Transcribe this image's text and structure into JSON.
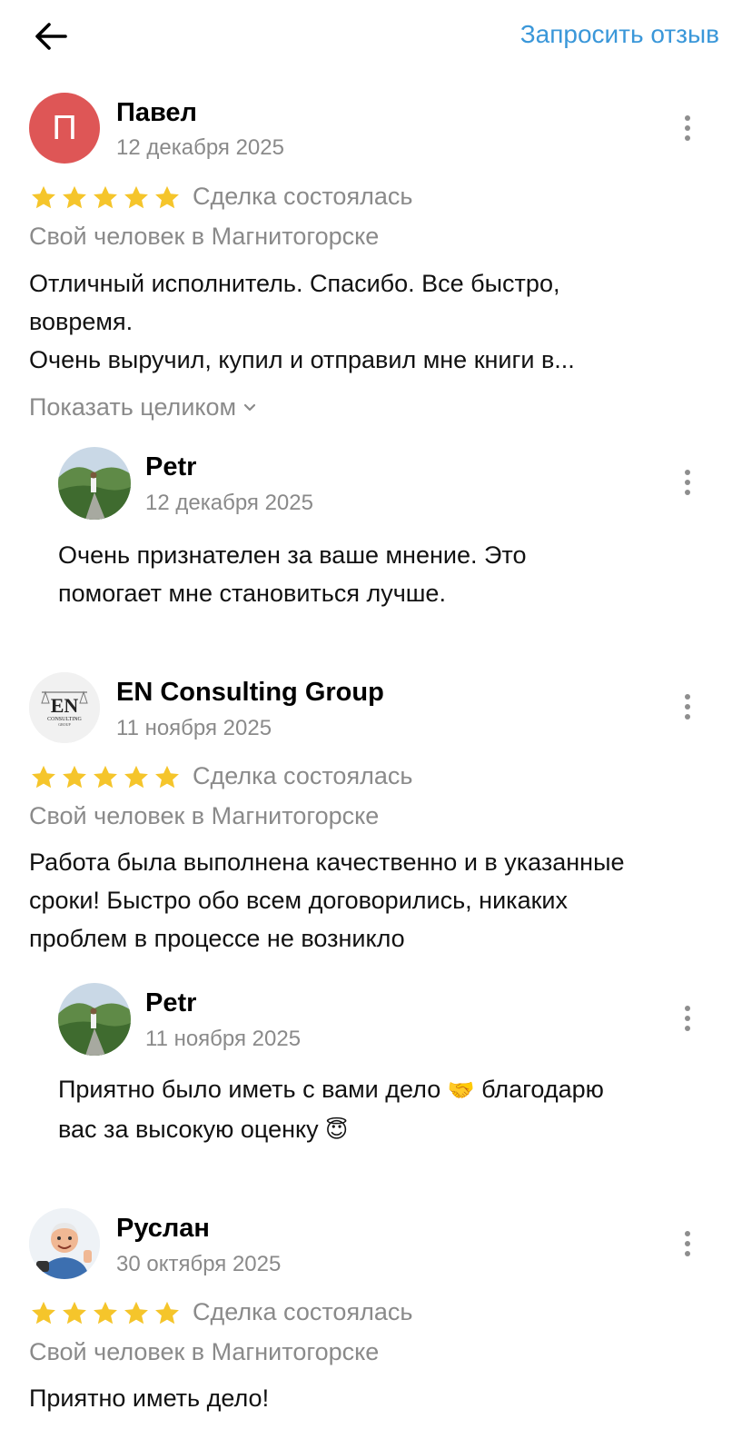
{
  "header": {
    "back_icon": "arrow-left-icon",
    "request_label": "Запросить отзыв",
    "accent_color": "#3a97d9"
  },
  "reviews": [
    {
      "author": "Павел",
      "avatar_letter": "П",
      "avatar_color": "#de5656",
      "date": "12 декабря 2025",
      "rating": 5,
      "deal": "Сделка состоялась",
      "category": "Свой человек в Магнитогорске",
      "text_lines": [
        "Отличный исполнитель. Спасибо. Все быстро,",
        "вовремя.",
        "Очень выручил, купил и отправил мне книги в..."
      ],
      "show_all": "Показать целиком",
      "reply": {
        "author": "Petr",
        "date": "12 декабря 2025",
        "text_lines": [
          "Очень признателен за ваше мнение. Это",
          "помогает мне становиться лучше."
        ]
      }
    },
    {
      "author": "EN Consulting Group",
      "avatar_logo_text": "EN",
      "avatar_logo_sub": "CONSULTING",
      "avatar_logo_sub2": "GROUP",
      "date": "11 ноября 2025",
      "rating": 5,
      "deal": "Сделка состоялась",
      "category": "Свой человек в Магнитогорске",
      "text_lines": [
        "Работа была выполнена качественно и в указанные",
        "сроки! Быстро обо всем договорились, никаких",
        "проблем в процессе не возникло"
      ],
      "reply": {
        "author": "Petr",
        "date": "11 ноября 2025",
        "text_line1_before": "Приятно было иметь с вами дело",
        "text_line1_emoji": "🤝",
        "text_line1_after": "благодарю",
        "text_line2_before": "вас за высокую оценку",
        "text_line2_emoji": "😇"
      }
    },
    {
      "author": "Руслан",
      "date": "30 октября 2025",
      "rating": 5,
      "deal": "Сделка состоялась",
      "category": "Свой человек в Магнитогорске",
      "text_lines": [
        "Приятно иметь дело!"
      ]
    }
  ],
  "colors": {
    "star": "#f5c52b",
    "muted_text": "#8a8a8a"
  }
}
